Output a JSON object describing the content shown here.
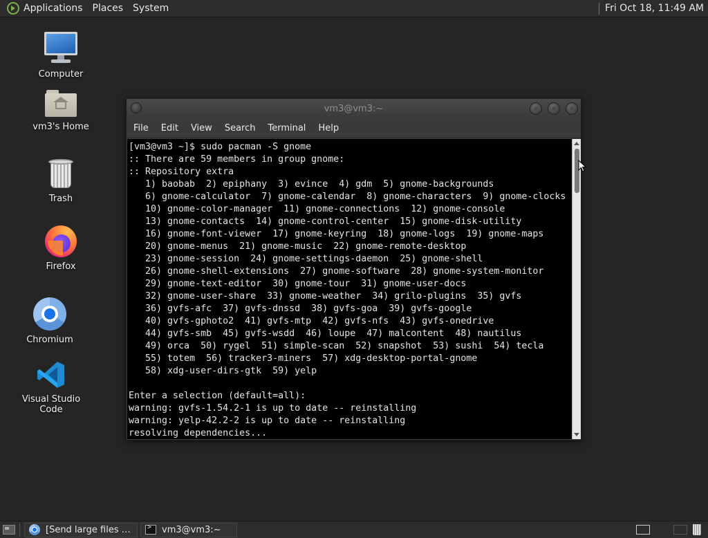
{
  "top_panel": {
    "menus": [
      "Applications",
      "Places",
      "System"
    ],
    "clock": "Fri Oct 18, 11:49 AM"
  },
  "desktop": {
    "icons": [
      {
        "label": "Computer",
        "icon": "computer-icon"
      },
      {
        "label": "vm3's Home",
        "icon": "home-folder-icon"
      },
      {
        "label": "Trash",
        "icon": "trash-icon"
      },
      {
        "label": "Firefox",
        "icon": "firefox-icon"
      },
      {
        "label": "Chromium",
        "icon": "chromium-icon"
      },
      {
        "label": "Visual Studio Code",
        "icon": "vscode-icon"
      }
    ]
  },
  "terminal": {
    "title": "vm3@vm3:~",
    "menu": [
      "File",
      "Edit",
      "View",
      "Search",
      "Terminal",
      "Help"
    ],
    "lines": [
      "[vm3@vm3 ~]$ sudo pacman -S gnome",
      ":: There are 59 members in group gnome:",
      ":: Repository extra",
      "   1) baobab  2) epiphany  3) evince  4) gdm  5) gnome-backgrounds",
      "   6) gnome-calculator  7) gnome-calendar  8) gnome-characters  9) gnome-clocks",
      "   10) gnome-color-manager  11) gnome-connections  12) gnome-console",
      "   13) gnome-contacts  14) gnome-control-center  15) gnome-disk-utility",
      "   16) gnome-font-viewer  17) gnome-keyring  18) gnome-logs  19) gnome-maps",
      "   20) gnome-menus  21) gnome-music  22) gnome-remote-desktop",
      "   23) gnome-session  24) gnome-settings-daemon  25) gnome-shell",
      "   26) gnome-shell-extensions  27) gnome-software  28) gnome-system-monitor",
      "   29) gnome-text-editor  30) gnome-tour  31) gnome-user-docs",
      "   32) gnome-user-share  33) gnome-weather  34) grilo-plugins  35) gvfs",
      "   36) gvfs-afc  37) gvfs-dnssd  38) gvfs-goa  39) gvfs-google",
      "   40) gvfs-gphoto2  41) gvfs-mtp  42) gvfs-nfs  43) gvfs-onedrive",
      "   44) gvfs-smb  45) gvfs-wsdd  46) loupe  47) malcontent  48) nautilus",
      "   49) orca  50) rygel  51) simple-scan  52) snapshot  53) sushi  54) tecla",
      "   55) totem  56) tracker3-miners  57) xdg-desktop-portal-gnome",
      "   58) xdg-user-dirs-gtk  59) yelp",
      "",
      "Enter a selection (default=all):",
      "warning: gvfs-1.54.2-1 is up to date -- reinstalling",
      "warning: yelp-42.2-2 is up to date -- reinstalling",
      "resolving dependencies..."
    ]
  },
  "bottom_panel": {
    "tasks": [
      {
        "label": "[Send large files up ...",
        "icon": "chromium-icon"
      },
      {
        "label": "vm3@vm3:~",
        "icon": "terminal-icon"
      }
    ]
  }
}
